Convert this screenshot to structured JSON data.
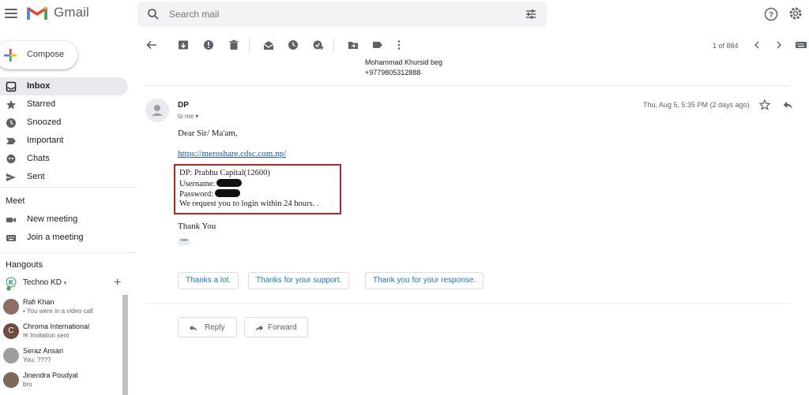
{
  "app": {
    "name": "Gmail"
  },
  "search": {
    "placeholder": "Search mail"
  },
  "sidebar": {
    "compose_label": "Compose",
    "items": [
      {
        "label": "Inbox",
        "icon": "inbox-icon"
      },
      {
        "label": "Starred",
        "icon": "star-icon"
      },
      {
        "label": "Snoozed",
        "icon": "clock-icon"
      },
      {
        "label": "Important",
        "icon": "important-icon"
      },
      {
        "label": "Chats",
        "icon": "chat-icon"
      },
      {
        "label": "Sent",
        "icon": "send-icon"
      }
    ],
    "meet": {
      "title": "Meet",
      "items": [
        {
          "label": "New meeting",
          "icon": "video-icon"
        },
        {
          "label": "Join a meeting",
          "icon": "keyboard-icon"
        }
      ]
    },
    "hangouts": {
      "title": "Hangouts",
      "user": "Techno KD",
      "contacts": [
        {
          "name": "Rafi Khan",
          "status": "You were in a video call",
          "color": "#8d6e63"
        },
        {
          "name": "Chroma International",
          "status": "Invitation sent",
          "initial": "C",
          "color": "#6d4c41"
        },
        {
          "name": "Seraz Ansari",
          "status": "You: ????",
          "color": "#9e9e9e"
        },
        {
          "name": "Jinendra Poudyal",
          "status": "bro",
          "color": "#7b6a58"
        }
      ]
    }
  },
  "toolbar": {
    "pager": "1 of 884"
  },
  "email": {
    "quoted_lines": [
      "Mohammad Khursid beg",
      "+9779805312888"
    ],
    "sender": "DP",
    "recipient": "to me",
    "date": "Thu, Aug 5, 5:35 PM (2 days ago)",
    "greeting": "Dear Sir/ Ma'am,",
    "link": "https://meroshare.cdsc.com.np/",
    "dp_line": "DP: Prabhu Capital(12600)",
    "username_label": "Username:",
    "password_label": "Password:",
    "request_line": "We request you to login within 24 hours. .",
    "signoff": "Thank You",
    "ellipsis": "•••"
  },
  "smart_replies": [
    "Thanks a lot.",
    "Thanks for your support.",
    "Thank you for your response."
  ],
  "actions": {
    "reply": "Reply",
    "forward": "Forward"
  },
  "colors": {
    "highlight_box": "#b3262e",
    "link": "#1155cc",
    "smart_reply_text": "#1a73e8"
  }
}
